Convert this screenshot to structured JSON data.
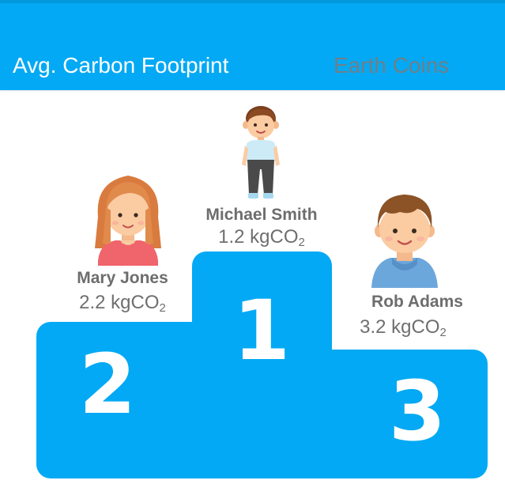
{
  "tabs": {
    "active_label": "Avg. Carbon Footprint",
    "inactive_label": "Earth Coins"
  },
  "leaderboard": {
    "first": {
      "rank": "1",
      "name": "Michael Smith",
      "value": "1.2 kgCO",
      "unit_sub": "2"
    },
    "second": {
      "rank": "2",
      "name": "Mary Jones",
      "value": "2.2 kgCO",
      "unit_sub": "2"
    },
    "third": {
      "rank": "3",
      "name": "Rob Adams",
      "value": "3.2 kgCO",
      "unit_sub": "2"
    }
  },
  "colors": {
    "primary": "#03A9F4",
    "inactive_tab_text": "#6f7f89",
    "name_text": "#6d6d6d"
  },
  "icons": {
    "first": "boy-full-body-avatar-icon",
    "second": "girl-avatar-icon",
    "third": "boy-avatar-icon"
  }
}
